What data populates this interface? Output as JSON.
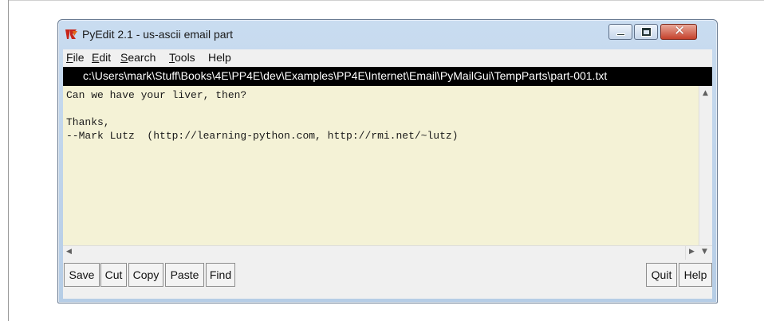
{
  "window": {
    "title": "PyEdit 2.1 - us-ascii email part",
    "app_icon": "tk-feather-icon",
    "controls": [
      "minimize-icon",
      "maximize-icon",
      "close-icon"
    ]
  },
  "menu": {
    "items": [
      {
        "label": "File",
        "ul": "F",
        "rest": "ile"
      },
      {
        "label": "Edit",
        "ul": "E",
        "rest": "dit"
      },
      {
        "label": "Search",
        "ul": "S",
        "rest": "earch"
      },
      {
        "label": "Tools",
        "ul": "T",
        "rest": "ools"
      },
      {
        "label": "Help",
        "ul": "",
        "rest": "Help"
      }
    ]
  },
  "path": "c:\\Users\\mark\\Stuff\\Books\\4E\\PP4E\\dev\\Examples\\PP4E\\Internet\\Email\\PyMailGui\\TempParts\\part-001.txt",
  "editor": {
    "content": "Can we have your liver, then?\n\nThanks,\n--Mark Lutz  (http://learning-python.com, http://rmi.net/~lutz)"
  },
  "toolbar": {
    "save": "Save",
    "cut": "Cut",
    "copy": "Copy",
    "paste": "Paste",
    "find": "Find",
    "quit": "Quit",
    "help": "Help"
  },
  "colors": {
    "editor_bg": "#f4f2d6",
    "path_bg": "#000000",
    "path_fg": "#ffffff",
    "titlebar": "#c9dcf0",
    "close_button": "#c5412b"
  }
}
